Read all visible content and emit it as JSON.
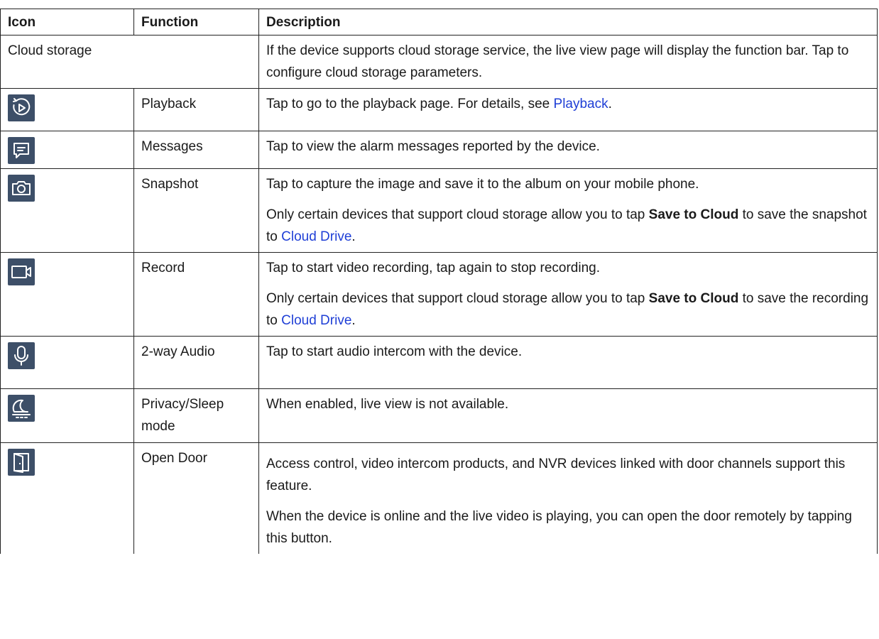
{
  "headers": {
    "icon": "Icon",
    "function": "Function",
    "description": "Description"
  },
  "cloud": {
    "label": "Cloud storage",
    "description": "If the device supports cloud storage service, the live view page will display the function bar. Tap to configure cloud storage parameters."
  },
  "rows": [
    {
      "icon": "playback-icon",
      "function": "Playback",
      "desc_pre": "Tap to go to the playback page. For details, see ",
      "desc_link": "Playback",
      "desc_post": "."
    },
    {
      "icon": "messages-icon",
      "function": "Messages",
      "desc": "Tap to view the alarm messages reported by the device."
    },
    {
      "icon": "camera-icon",
      "function": "Snapshot",
      "desc": "Tap to capture the image and save it to the album on your mobile phone.",
      "note_pre": "Only certain devices that support cloud storage allow you to tap ",
      "note_bold": "Save to Cloud",
      "note_mid": " to save the snapshot to ",
      "note_link": "Cloud Drive",
      "note_post": "."
    },
    {
      "icon": "video-record-icon",
      "function": "Record",
      "desc": "Tap to start video recording, tap again to stop recording.",
      "note_pre": "Only certain devices that support cloud storage allow you to tap ",
      "note_bold": "Save to Cloud",
      "note_mid": " to save the recording to ",
      "note_link": "Cloud Drive",
      "note_post": "."
    },
    {
      "icon": "microphone-icon",
      "function": "2-way Audio",
      "desc": "Tap to start audio intercom with the device."
    },
    {
      "icon": "sleep-moon-icon",
      "function": "Privacy/Sleep mode",
      "desc": "When enabled, live view is not available."
    },
    {
      "icon": "door-icon",
      "function": "Open Door",
      "desc": "Access control, video intercom products, and NVR devices linked with door channels support this feature.",
      "note": "When the device is online and the live video is playing, you can open the door remotely by tapping this button."
    }
  ],
  "colors": {
    "icon_bg": "#3d4f68",
    "link": "#1f3fd6",
    "border": "#222222"
  }
}
